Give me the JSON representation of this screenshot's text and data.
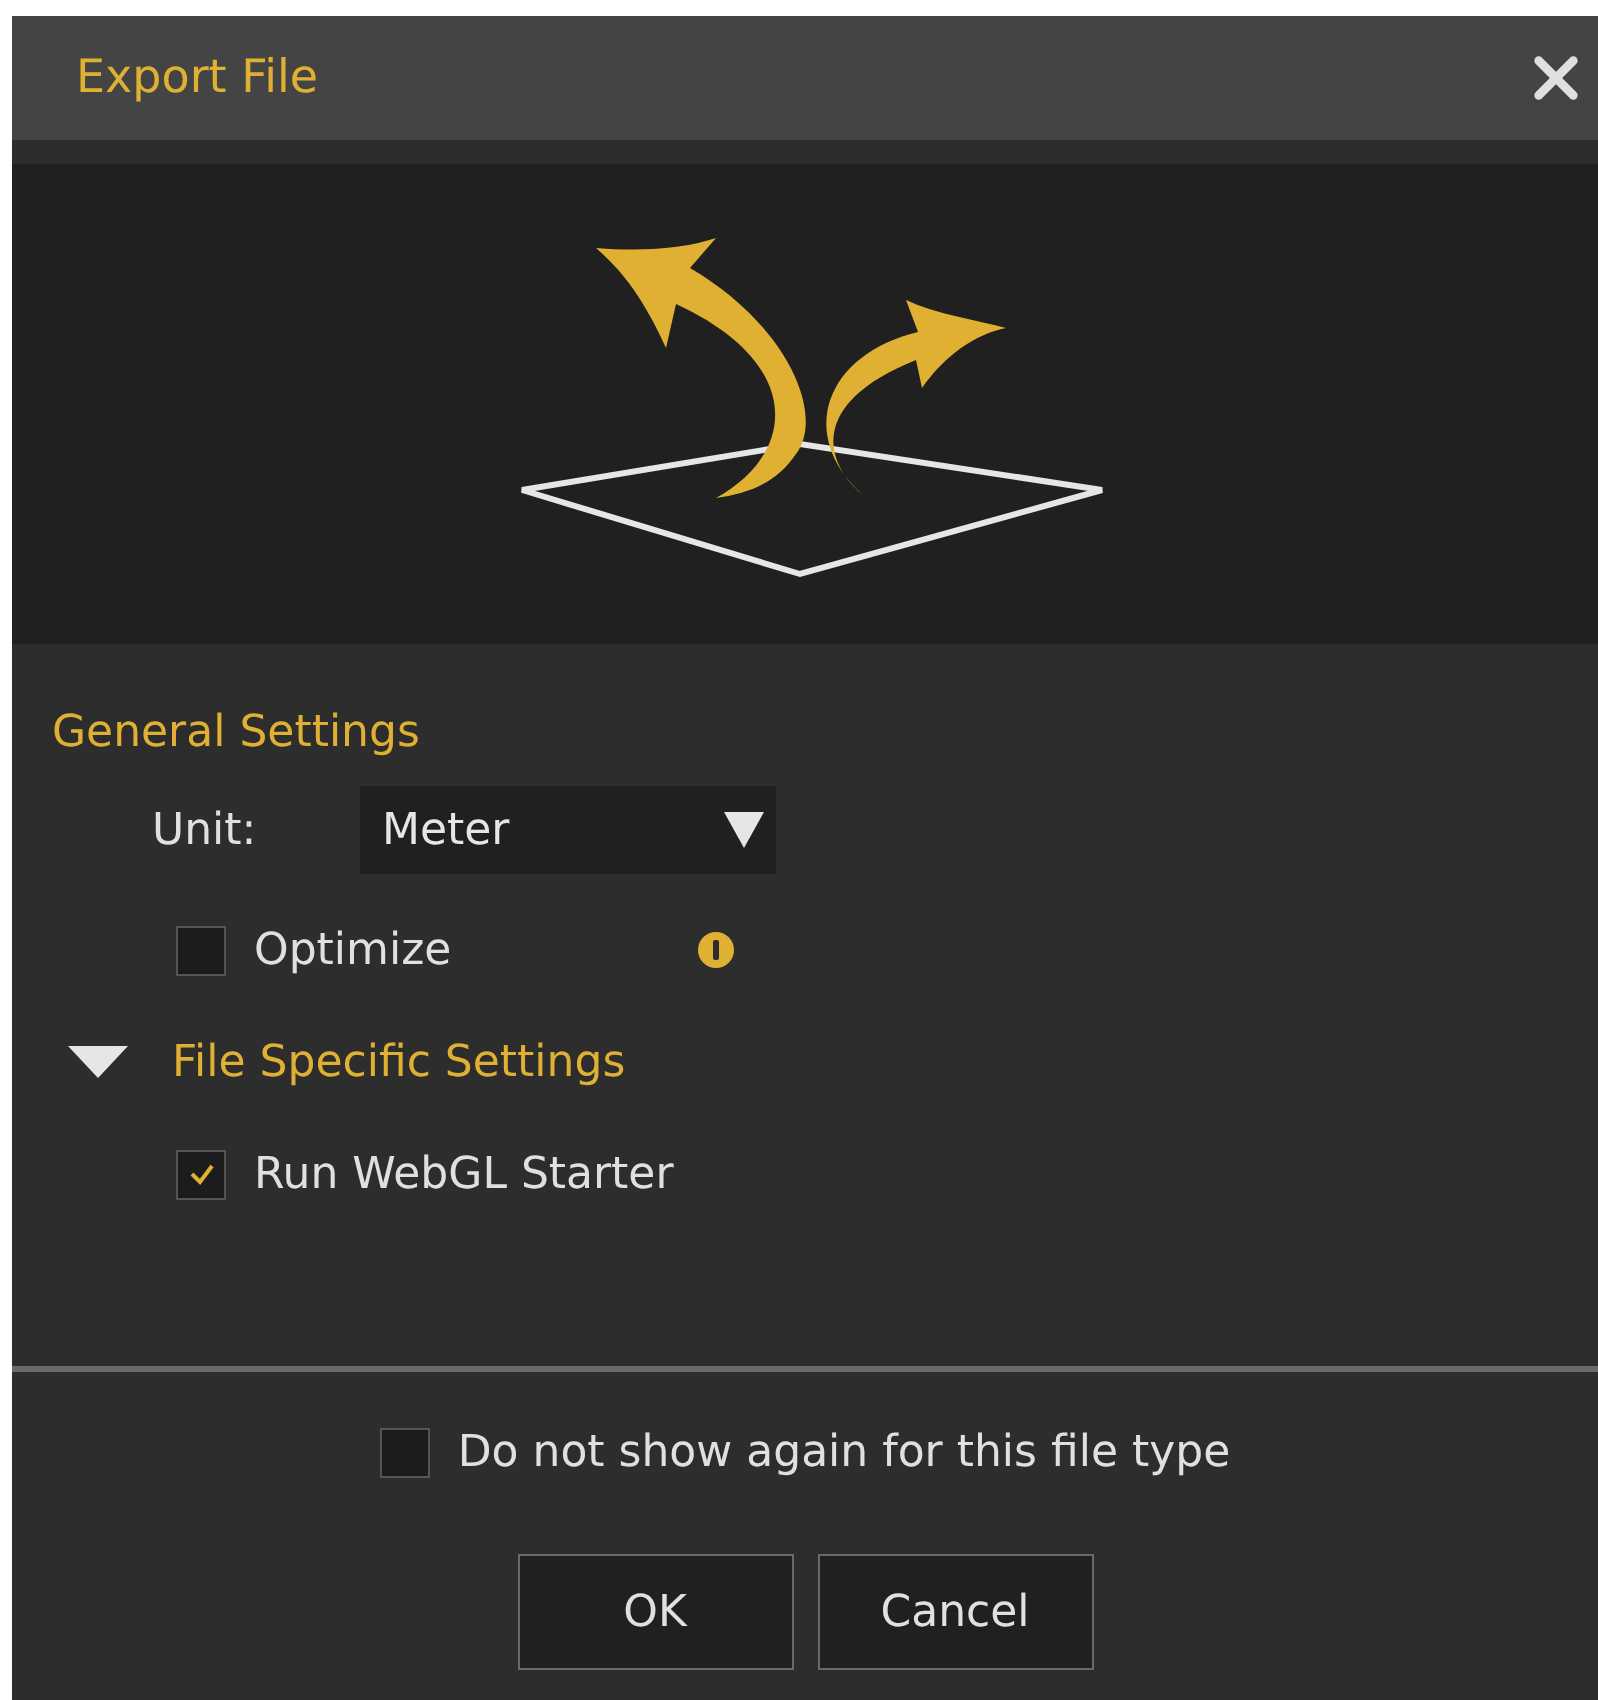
{
  "window": {
    "title": "Export File"
  },
  "general_settings": {
    "heading": "General Settings",
    "unit": {
      "label": "Unit:",
      "value": "Meter"
    },
    "options": [
      {
        "label": "Optimize",
        "checked": false,
        "info": true
      }
    ]
  },
  "file_specific_settings": {
    "heading": "File Specific Settings",
    "expanded": true,
    "options": [
      {
        "label": "Run WebGL Starter",
        "checked": true,
        "info": false
      }
    ]
  },
  "footer": {
    "do_not_show": {
      "label": "Do not show again for this file type",
      "checked": false
    },
    "buttons": [
      "OK",
      "Cancel"
    ]
  }
}
